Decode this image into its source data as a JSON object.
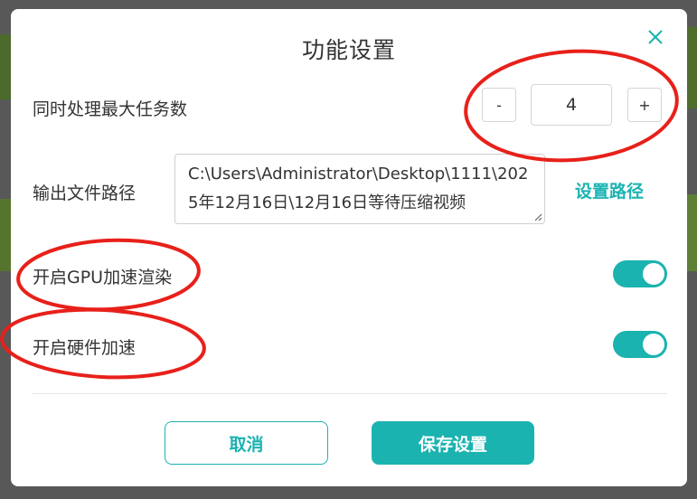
{
  "dialog": {
    "title": "功能设置",
    "close_icon": "close-icon"
  },
  "max_tasks": {
    "label": "同时处理最大任务数",
    "value": "4",
    "decrement_label": "-",
    "increment_label": "+"
  },
  "output_path": {
    "label": "输出文件路径",
    "value": "C:\\Users\\Administrator\\Desktop\\1111\\2025年12月16日\\12月16日等待压缩视频",
    "set_path_label": "设置路径"
  },
  "gpu_render": {
    "label": "开启GPU加速渲染",
    "enabled": true
  },
  "hardware_accel": {
    "label": "开启硬件加速",
    "enabled": true
  },
  "footer": {
    "cancel_label": "取消",
    "save_label": "保存设置"
  },
  "colors": {
    "accent": "#1ab3b0",
    "annotation": "#e8201a"
  }
}
